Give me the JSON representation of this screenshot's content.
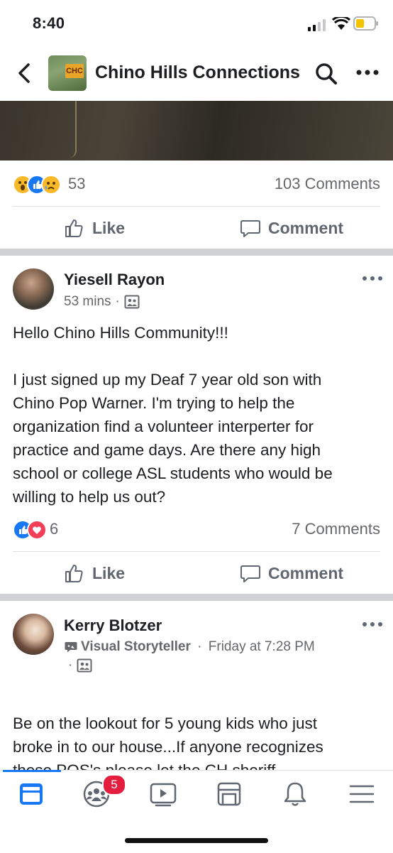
{
  "status_bar": {
    "time": "8:40"
  },
  "header": {
    "group_name": "Chino Hills Connections",
    "group_logo_text": "CHC"
  },
  "post1_footer": {
    "reaction_count": "53",
    "comments": "103 Comments",
    "like_label": "Like",
    "comment_label": "Comment"
  },
  "post2": {
    "author": "Yiesell Rayon",
    "time": "53 mins",
    "greeting": "Hello Chino Hills Community!!!",
    "body_lines": [
      "I just signed up my Deaf 7 year old son with",
      "Chino Pop Warner. I'm trying to help the",
      "organization find a volunteer interperter for",
      "practice and game days. Are there any high",
      "school or college ASL students who would be",
      "willing to help us out?"
    ],
    "reaction_count": "6",
    "comments": "7 Comments",
    "like_label": "Like",
    "comment_label": "Comment"
  },
  "post3": {
    "author": "Kerry Blotzer",
    "badge": "Visual Storyteller",
    "time": "Friday at 7:28 PM",
    "body_lines": [
      "Be on the lookout for 5 young kids who just",
      "broke in to our house...If anyone recognizes",
      "these POS's please let the CH sheriff"
    ]
  },
  "tabbar": {
    "groups_badge": "5"
  },
  "colors": {
    "accent": "#1877f2",
    "badge": "#e41e3f"
  }
}
